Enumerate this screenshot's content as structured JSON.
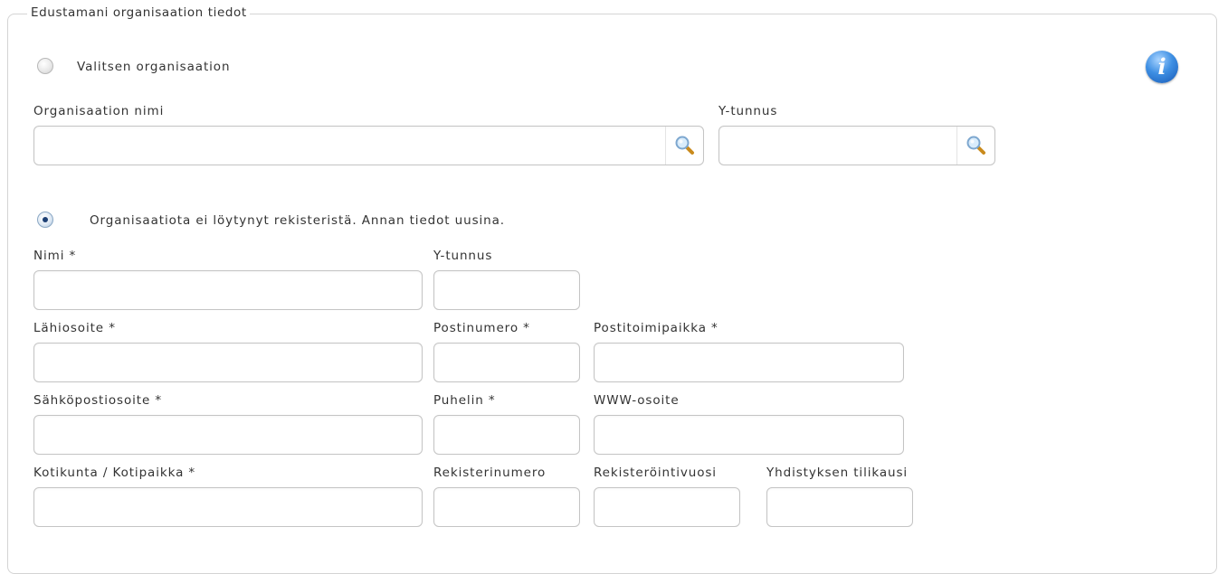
{
  "fieldset": {
    "legend": "Edustamani organisaation tiedot"
  },
  "info_button": {
    "glyph": "i",
    "icon": "info-icon",
    "color": "#2f7fd8"
  },
  "option_select": {
    "label": "Valitsen organisaation",
    "selected": false,
    "org_name_label": "Organisaation nimi",
    "org_name_value": "",
    "ytunnus_label": "Y-tunnus",
    "ytunnus_value": "",
    "search_icon": "magnifier-icon"
  },
  "option_new": {
    "label": "Organisaatiota ei löytynyt rekisteristä. Annan tiedot uusina.",
    "selected": true
  },
  "form": {
    "nimi_label": "Nimi *",
    "ytunnus_label": "Y-tunnus",
    "lahiosoite_label": "Lähiosoite *",
    "postinumero_label": "Postinumero *",
    "postitoimipaikka_label": "Postitoimipaikka *",
    "sahkoposti_label": "Sähköpostiosoite *",
    "puhelin_label": "Puhelin *",
    "www_label": "WWW-osoite",
    "kotikunta_label": "Kotikunta / Kotipaikka *",
    "rekisterinumero_label": "Rekisterinumero",
    "rekisterointivuosi_label": "Rekisteröintivuosi",
    "tilikausi_label": "Yhdistyksen tilikausi"
  }
}
